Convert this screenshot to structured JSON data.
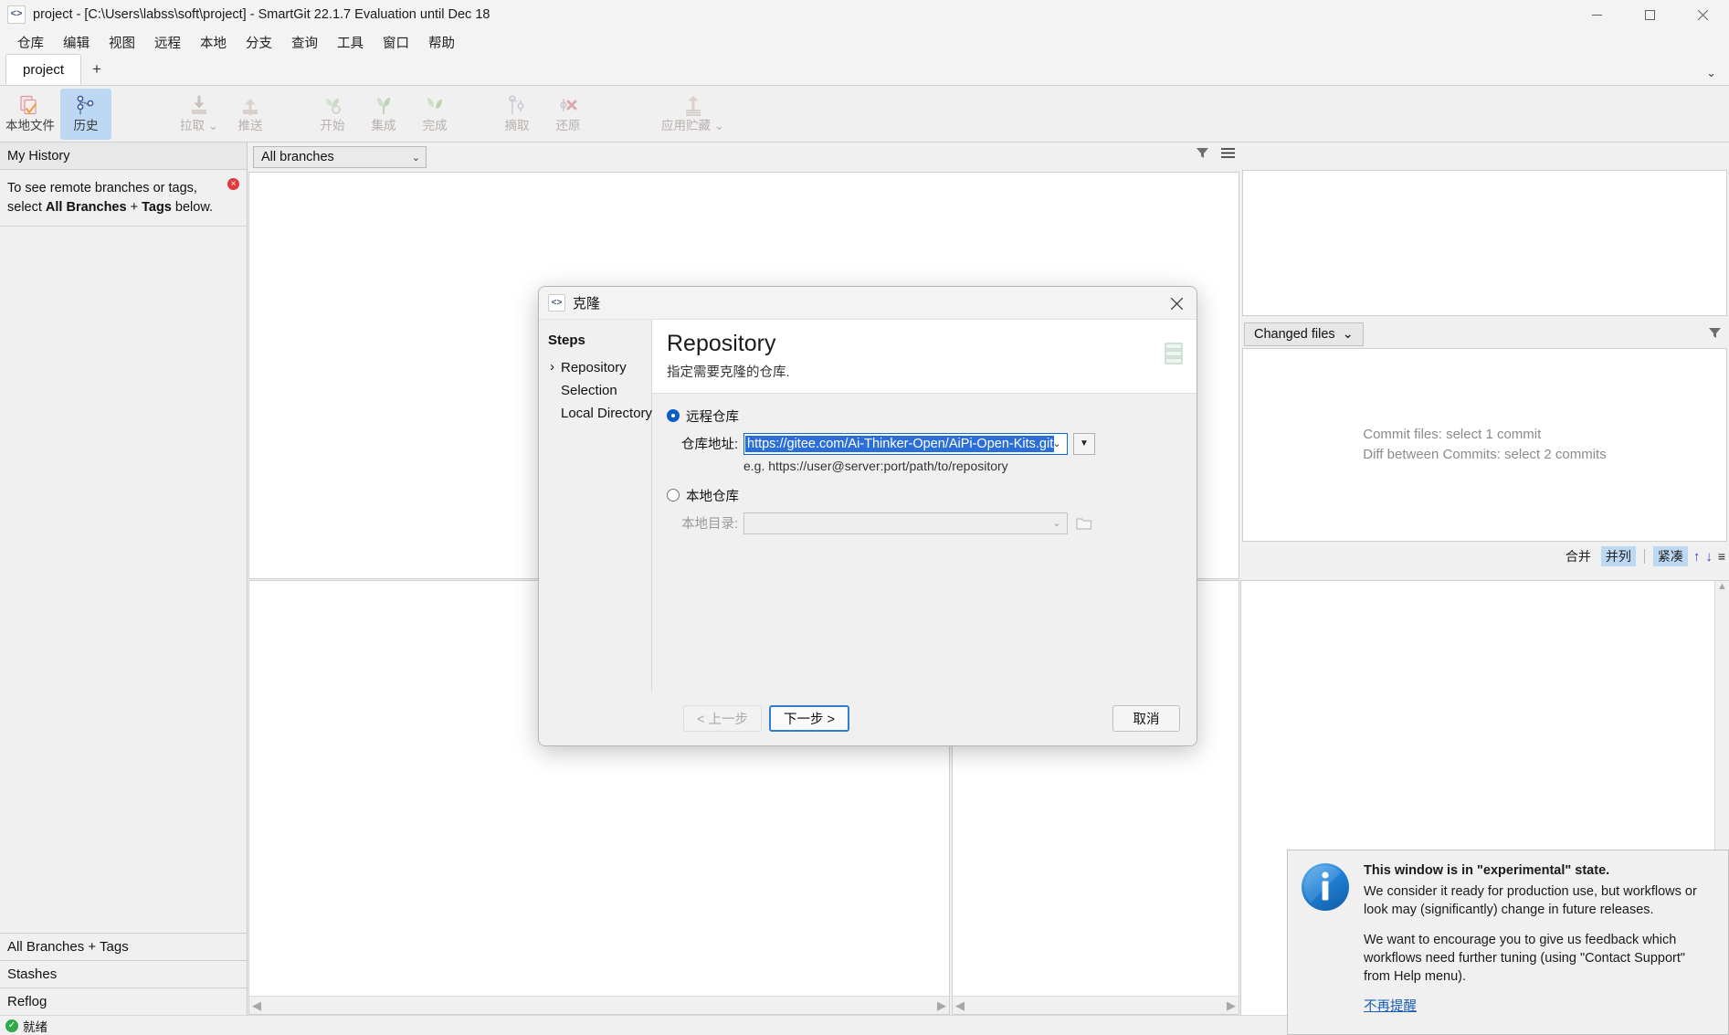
{
  "window": {
    "title": "project - [C:\\Users\\labss\\soft\\project] - SmartGit 22.1.7 Evaluation until Dec 18",
    "app_icon": "code-brackets-icon",
    "minimize": "—",
    "maximize": "□",
    "close": "✕"
  },
  "menubar": {
    "items": [
      {
        "label": "仓库"
      },
      {
        "label": "编辑"
      },
      {
        "label": "视图"
      },
      {
        "label": "远程"
      },
      {
        "label": "本地"
      },
      {
        "label": "分支"
      },
      {
        "label": "查询"
      },
      {
        "label": "工具"
      },
      {
        "label": "窗口"
      },
      {
        "label": "帮助"
      }
    ]
  },
  "tabbar": {
    "tabs": [
      {
        "label": "project"
      }
    ],
    "add_label": "+",
    "overflow_chevron": "⌄"
  },
  "toolbar": {
    "buttons": [
      {
        "label": "本地文件",
        "icon": "working-tree-icon",
        "state": "normal"
      },
      {
        "label": "历史",
        "icon": "history-graph-icon",
        "state": "selected"
      },
      {
        "label": "拉取 ⌄",
        "icon": "pull-down-arrow-icon",
        "state": "disabled"
      },
      {
        "label": "推送",
        "icon": "push-up-arrow-icon",
        "state": "disabled"
      },
      {
        "label": "开始",
        "icon": "flow-start-icon",
        "state": "disabled"
      },
      {
        "label": "集成",
        "icon": "flow-integrate-icon",
        "state": "disabled"
      },
      {
        "label": "完成",
        "icon": "flow-finish-icon",
        "state": "disabled"
      },
      {
        "label": "摘取",
        "icon": "cherry-pick-icon",
        "state": "disabled"
      },
      {
        "label": "还原",
        "icon": "revert-icon",
        "state": "disabled"
      },
      {
        "label": "应用贮藏 ⌄",
        "icon": "apply-stash-icon",
        "state": "disabled"
      }
    ]
  },
  "left_panel": {
    "header": "My History",
    "hint": {
      "part1": "To see remote branches or tags,",
      "part2_prefix": "select ",
      "part2_bold_a": "All Branches",
      "part2_mid": " + ",
      "part2_bold_b": "Tags",
      "part2_suffix": " below.",
      "close": "×"
    },
    "bottom_items": [
      {
        "label": "All Branches + Tags"
      },
      {
        "label": "Stashes"
      },
      {
        "label": "Reflog"
      }
    ]
  },
  "center": {
    "branch_filter": {
      "value": "All branches",
      "chevron": "⌄"
    },
    "filter_icon": "funnel-icon",
    "menu_icon": "hamburger-menu-icon"
  },
  "right_panel": {
    "changed_files_tab": {
      "label": "Changed files",
      "chevron": "⌄"
    },
    "filter_icon": "funnel-icon",
    "empty_state": {
      "line1": "Commit files: select 1 commit",
      "line2": "Diff between Commits: select 2 commits"
    },
    "diff_options": {
      "merge": "合并",
      "side_by_side": "并列",
      "compact": "紧凑",
      "up_arrow": "↑",
      "down_arrow": "↓",
      "menu": "≡"
    }
  },
  "scrollbars": {
    "left_arrow": "◀",
    "right_arrow": "▶",
    "up_arrow": "▲",
    "down_arrow": "▼"
  },
  "statusbar": {
    "icon": "ready-check-icon",
    "check": "✓",
    "text": "就绪"
  },
  "dialog": {
    "caption": "克隆",
    "icon": "code-brackets-icon",
    "close": "✕",
    "steps_title": "Steps",
    "steps": [
      {
        "label": "Repository",
        "active": true
      },
      {
        "label": "Selection",
        "active": false
      },
      {
        "label": "Local Directory",
        "active": false
      }
    ],
    "heading": "Repository",
    "subheading": "指定需要克隆的仓库.",
    "head_icon": "database-stack-icon",
    "remote": {
      "radio_label": "远程仓库",
      "selected": true,
      "field_label": "仓库地址:",
      "value": "https://gitee.com/Ai-Thinker-Open/AiPi-Open-Kits.git",
      "chevron": "⌄",
      "dropdown_button": "▼",
      "example": "e.g. https://user@server:port/path/to/repository"
    },
    "local": {
      "radio_label": "本地仓库",
      "selected": false,
      "field_label": "本地目录:",
      "value": "",
      "chevron": "⌄",
      "browse_icon": "folder-open-icon"
    },
    "buttons": {
      "back": "< 上一步",
      "next": "下一步 >",
      "cancel": "取消"
    }
  },
  "notification": {
    "icon": "info-circle-icon",
    "title": "This window is in \"experimental\" state.",
    "paragraph1": "We consider it ready for production use, but workflows or look may (significantly) change in future releases.",
    "paragraph2": "We want to encourage you to give us feedback which workflows need further tuning (using \"Contact Support\" from Help menu).",
    "link": "不再提醒"
  },
  "colors": {
    "accent_blue": "#2b6fd6",
    "selection_blue": "#bcd8f2",
    "link_blue": "#1a5fb4",
    "ready_green": "#2faa46",
    "error_red": "#e03b3b"
  }
}
